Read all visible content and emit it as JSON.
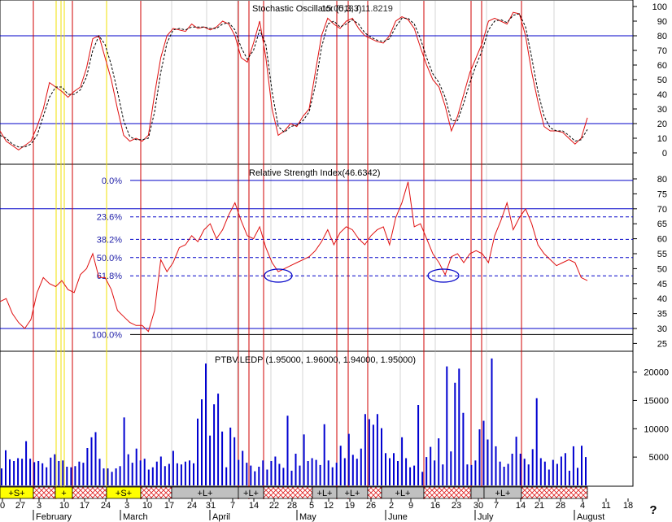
{
  "chart_data": [
    {
      "type": "line",
      "title": "Stochastic Oscillator (5,3,3)",
      "title_overlay_value": "15.0013 / 11.8219",
      "ylim": [
        -5,
        105
      ],
      "yticks": [
        0,
        10,
        20,
        30,
        40,
        50,
        60,
        70,
        80,
        90,
        100
      ],
      "reference_lines": [
        80,
        20
      ],
      "series": [
        {
          "style": "red-solid",
          "values": [
            15,
            8,
            5,
            2,
            5,
            8,
            18,
            30,
            48,
            45,
            42,
            38,
            42,
            45,
            58,
            78,
            80,
            65,
            50,
            30,
            12,
            8,
            10,
            8,
            12,
            40,
            65,
            80,
            85,
            84,
            83,
            88,
            85,
            86,
            84,
            86,
            90,
            88,
            80,
            65,
            62,
            75,
            90,
            65,
            30,
            12,
            15,
            20,
            18,
            25,
            30,
            55,
            80,
            92,
            88,
            85,
            90,
            92,
            85,
            80,
            78,
            76,
            75,
            80,
            90,
            93,
            91,
            85,
            72,
            60,
            50,
            45,
            32,
            15,
            25,
            40,
            55,
            65,
            75,
            90,
            92,
            90,
            88,
            96,
            95,
            80,
            55,
            35,
            18,
            15,
            15,
            14,
            10,
            6,
            10,
            24
          ]
        },
        {
          "style": "black-dotted",
          "values": [
            12,
            10,
            6,
            4,
            4,
            6,
            12,
            25,
            38,
            45,
            45,
            40,
            40,
            43,
            52,
            70,
            80,
            74,
            60,
            42,
            22,
            11,
            9,
            9,
            10,
            28,
            55,
            75,
            84,
            85,
            84,
            86,
            86,
            86,
            85,
            85,
            88,
            89,
            84,
            72,
            64,
            70,
            84,
            74,
            42,
            18,
            14,
            18,
            19,
            22,
            28,
            46,
            72,
            88,
            90,
            86,
            88,
            91,
            88,
            82,
            79,
            77,
            76,
            78,
            86,
            92,
            92,
            88,
            78,
            65,
            54,
            48,
            38,
            22,
            22,
            34,
            48,
            60,
            70,
            84,
            90,
            91,
            89,
            94,
            95,
            86,
            65,
            42,
            25,
            17,
            15,
            15,
            12,
            8,
            9,
            16
          ]
        }
      ]
    },
    {
      "type": "line",
      "title": "Relative Strength Index(46.6342)",
      "ylim": [
        22,
        82
      ],
      "yticks": [
        25,
        30,
        35,
        40,
        45,
        50,
        55,
        60,
        65,
        70,
        75,
        80
      ],
      "reference_lines": [
        70,
        30
      ],
      "fibonacci_levels": [
        {
          "label": "0.0%",
          "value": 79.5
        },
        {
          "label": "23.6%",
          "value": 67.3
        },
        {
          "label": "38.2%",
          "value": 59.8
        },
        {
          "label": "50.0%",
          "value": 53.7
        },
        {
          "label": "61.8%",
          "value": 47.6
        },
        {
          "label": "100.0%",
          "value": 28.0
        }
      ],
      "series": [
        {
          "style": "red-solid",
          "values": [
            39,
            40,
            35,
            32,
            30,
            33,
            42,
            47,
            45,
            44,
            46,
            43,
            42,
            48,
            50,
            55,
            47,
            47,
            43,
            36,
            34,
            32,
            31,
            31,
            29,
            36,
            53,
            49,
            52,
            57,
            58,
            61,
            59,
            63,
            65,
            60,
            63,
            68,
            72,
            66,
            61,
            60,
            64,
            57,
            52,
            49,
            50,
            51,
            52,
            53,
            54,
            56,
            59,
            63,
            58,
            62,
            64,
            63,
            60,
            58,
            61,
            63,
            64,
            58,
            67,
            72,
            79,
            64,
            65,
            60,
            55,
            52,
            48,
            54,
            55,
            52,
            55,
            56,
            55,
            52,
            61,
            66,
            72,
            63,
            67,
            70,
            65,
            58,
            55,
            53,
            51,
            52,
            53,
            52,
            47,
            46
          ]
        }
      ]
    },
    {
      "type": "bar",
      "title": "PTBV.LEDP (1.95000, 1.96000, 1.94000, 1.95000)",
      "ylim": [
        0,
        24000
      ],
      "yticks": [
        5000,
        10000,
        15000,
        20000
      ],
      "values": [
        3000,
        6200,
        4600,
        4300,
        4800,
        4700,
        7800,
        4700,
        4100,
        4300,
        3900,
        3200,
        4900,
        5500,
        4300,
        4400,
        3300,
        3200,
        3400,
        4200,
        4000,
        6600,
        8500,
        9400,
        4700,
        3000,
        3000,
        2400,
        3000,
        3400,
        12000,
        5500,
        4000,
        6500,
        4400,
        4700,
        2800,
        3200,
        4200,
        5100,
        3400,
        3800,
        6100,
        3900,
        3700,
        4200,
        4400,
        3900,
        11800,
        15200,
        21500,
        8800,
        14300,
        16200,
        9500,
        3200,
        10200,
        8500,
        4500,
        6100,
        4000,
        3500,
        2500,
        3300,
        4400,
        2800,
        4300,
        5100,
        3800,
        3100,
        12300,
        2600,
        5600,
        3500,
        9000,
        4300,
        4800,
        4500,
        3600,
        10800,
        4400,
        3200,
        4000,
        7000,
        4800,
        9100,
        5400,
        4700,
        6500,
        12600,
        11700,
        10700,
        12600,
        10100,
        5700,
        4800,
        5700,
        4300,
        8500,
        4800,
        3200,
        3500,
        14200,
        2400,
        5000,
        6800,
        4400,
        8300,
        3700,
        21000,
        6000,
        18100,
        20600,
        12800,
        3700,
        3600,
        4400,
        9900,
        11400,
        8100,
        22400,
        6900,
        4200,
        3300,
        3800,
        5600,
        8600,
        5600,
        4700,
        3700,
        6400,
        15400,
        4800,
        4200,
        2800,
        4500,
        3800,
        5100,
        5700,
        2600,
        6900,
        3100,
        7000,
        5000
      ]
    }
  ],
  "x_axis": {
    "day_labels": [
      "0",
      "27",
      "3",
      "10",
      "17",
      "24",
      "3",
      "10",
      "17",
      "24",
      "31",
      "7",
      "14",
      "22",
      "28",
      "5",
      "12",
      "19",
      "26",
      "2",
      "9",
      "16",
      "23",
      "30",
      "7",
      "14",
      "21",
      "28",
      "4",
      "11",
      "18"
    ],
    "month_labels": [
      "February",
      "March",
      "April",
      "May",
      "June",
      "July",
      "August"
    ]
  },
  "signal_strip": {
    "segments": [
      {
        "kind": "S",
        "label": "+S+"
      },
      {
        "kind": "hatch",
        "label": ""
      },
      {
        "kind": "S",
        "label": "+"
      },
      {
        "kind": "hatch",
        "label": ""
      },
      {
        "kind": "S",
        "label": "+S+"
      },
      {
        "kind": "hatch",
        "label": ""
      },
      {
        "kind": "L",
        "label": "+L+"
      },
      {
        "kind": "L",
        "label": "+L+"
      },
      {
        "kind": "hatch",
        "label": ""
      },
      {
        "kind": "L",
        "label": "+L+"
      },
      {
        "kind": "L",
        "label": "+L+"
      },
      {
        "kind": "hatch",
        "label": ""
      },
      {
        "kind": "L",
        "label": "+L+"
      },
      {
        "kind": "hatch",
        "label": ""
      },
      {
        "kind": "L",
        "label": ""
      },
      {
        "kind": "L",
        "label": "+L+"
      },
      {
        "kind": "hatch",
        "label": ""
      }
    ]
  },
  "help_label": "?",
  "colors": {
    "line_red": "#e01010",
    "ref_blue": "#0000c8",
    "bar_blue": "#0000d0",
    "event_red": "#d00000",
    "event_yellow": "#f0e000",
    "grid_gray": "#b8b8b8",
    "strip_yellow": "#ffff00",
    "strip_gray": "#c0c0c0"
  }
}
